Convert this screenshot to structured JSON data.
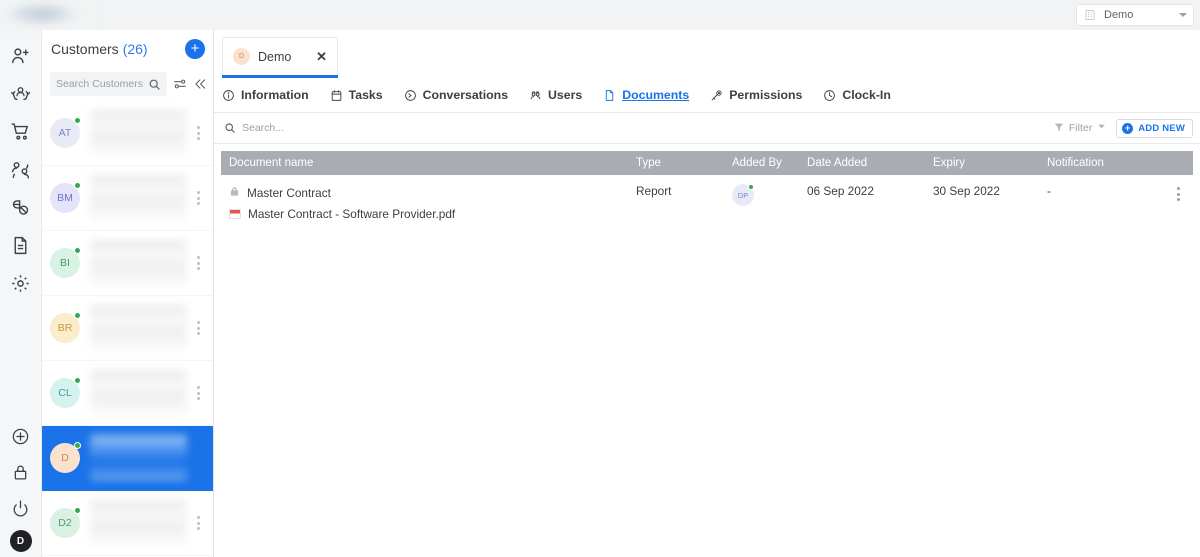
{
  "topbar": {
    "logo_icon": "app-logo",
    "org_selector": {
      "icon": "building-icon",
      "label": "Demo",
      "caret": "chevron-down-icon"
    }
  },
  "rail": {
    "top_items": [
      {
        "name": "add-user-icon",
        "label": "Add User"
      },
      {
        "name": "customer-care-icon",
        "label": "Customer Care"
      },
      {
        "name": "shopping-cart-icon",
        "label": "Orders"
      },
      {
        "name": "contacts-icon",
        "label": "Contacts"
      },
      {
        "name": "pills-icon",
        "label": "Products"
      },
      {
        "name": "document-icon",
        "label": "Documents"
      },
      {
        "name": "gear-icon",
        "label": "Settings"
      }
    ],
    "bottom_items": [
      {
        "name": "plus-circle-icon",
        "label": "Add"
      },
      {
        "name": "lock-icon",
        "label": "Lock"
      },
      {
        "name": "power-icon",
        "label": "Log Out"
      }
    ],
    "user_avatar": "D"
  },
  "customers": {
    "title": "Customers",
    "count": "(26)",
    "add_label": "+",
    "search": {
      "placeholder": "Search Customers",
      "value": ""
    },
    "search_icon": "search-icon",
    "filter_icon": "sliders-icon",
    "collapse_icon": "chevron-double-left-icon",
    "rows": [
      {
        "initials": "AT",
        "bg": "#e8eaf6",
        "fg": "#7986cb",
        "selected": false
      },
      {
        "initials": "BM",
        "bg": "#e3e4f7",
        "fg": "#6f74c9",
        "selected": false
      },
      {
        "initials": "BI",
        "bg": "#d9f2e4",
        "fg": "#3f9a6b",
        "selected": false
      },
      {
        "initials": "BR",
        "bg": "#fbeccc",
        "fg": "#c79a3c",
        "selected": false
      },
      {
        "initials": "CL",
        "bg": "#d4f3ef",
        "fg": "#3fa096",
        "selected": false
      },
      {
        "initials": "D",
        "bg": "#fbe2cf",
        "fg": "#c78a55",
        "selected": true
      },
      {
        "initials": "D2",
        "bg": "#d9f0e3",
        "fg": "#4a9e73",
        "selected": false
      }
    ]
  },
  "main": {
    "doc_tab": {
      "avatar": "D",
      "label": "Demo",
      "close_icon": "close-icon"
    },
    "nav_tabs": [
      {
        "label": "Information",
        "icon": "info-circle-icon",
        "active": false
      },
      {
        "label": "Tasks",
        "icon": "calendar-icon",
        "active": false
      },
      {
        "label": "Conversations",
        "icon": "chat-bubble-icon",
        "active": false
      },
      {
        "label": "Users",
        "icon": "users-icon",
        "active": false
      },
      {
        "label": "Documents",
        "icon": "document-icon",
        "active": true
      },
      {
        "label": "Permissions",
        "icon": "key-icon",
        "active": false
      },
      {
        "label": "Clock-In",
        "icon": "clock-icon",
        "active": false
      }
    ],
    "toolbar": {
      "search_placeholder": "Search...",
      "search_value": "",
      "search_icon": "search-icon",
      "filter_label": "Filter",
      "filter_icon": "funnel-icon",
      "filter_caret": "chevron-down-icon",
      "add_new_label": "ADD NEW",
      "add_new_plus": "+"
    },
    "table": {
      "columns": [
        "Document name",
        "Type",
        "Added By",
        "Date Added",
        "Expiry",
        "Notification"
      ],
      "rows": [
        {
          "lock_icon": "lock-icon",
          "name": "Master Contract",
          "file_icon": "pdf-icon",
          "file_name": "Master Contract - Software Provider.pdf",
          "type": "Report",
          "added_by": "DP",
          "date_added": "06 Sep 2022",
          "expiry": "30 Sep 2022",
          "notification": "-",
          "actions_icon": "kebab-menu-icon"
        }
      ]
    }
  },
  "colors": {
    "accent": "#1a73e8",
    "header_gray": "#a9adb3",
    "online": "#34a853",
    "pdf_red": "#e8564a"
  }
}
